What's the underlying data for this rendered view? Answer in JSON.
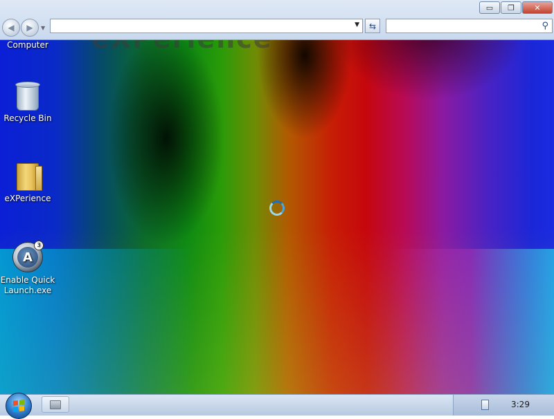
{
  "window": {
    "controls": {
      "minimize": "▭",
      "restore": "❐",
      "close": "✕"
    }
  },
  "toolbar": {
    "back_icon": "back-arrow-icon",
    "forward_icon": "forward-arrow-icon",
    "address_value": "",
    "address_placeholder": "",
    "search_value": "",
    "search_placeholder": ""
  },
  "desktop": {
    "watermark_text": "eXPerience",
    "icons": [
      {
        "label": "Computer",
        "icon": "computer-icon"
      },
      {
        "label": "Recycle Bin",
        "icon": "recycle-bin-icon"
      },
      {
        "label": "eXPerience",
        "icon": "folder-icon"
      },
      {
        "label": "Enable Quick Launch.exe",
        "icon": "quick-launch-app-icon"
      }
    ]
  },
  "taskbar": {
    "start_icon": "windows-start-orb",
    "pinned": [
      {
        "icon": "windows-explorer-icon"
      }
    ],
    "tray": {
      "icon": "notification-icon",
      "clock": "3:29"
    }
  },
  "colors": {
    "taskbar": "#c8d6ea",
    "toolbar": "#d6e2f2",
    "spinner": "#4aa6da"
  }
}
